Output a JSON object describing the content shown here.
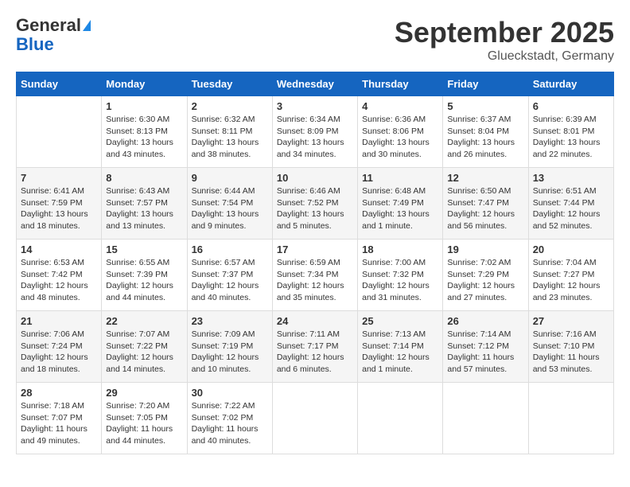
{
  "header": {
    "logo_general": "General",
    "logo_blue": "Blue",
    "month": "September 2025",
    "location": "Glueckstadt, Germany"
  },
  "days_of_week": [
    "Sunday",
    "Monday",
    "Tuesday",
    "Wednesday",
    "Thursday",
    "Friday",
    "Saturday"
  ],
  "weeks": [
    [
      {
        "day": "",
        "info": ""
      },
      {
        "day": "1",
        "info": "Sunrise: 6:30 AM\nSunset: 8:13 PM\nDaylight: 13 hours\nand 43 minutes."
      },
      {
        "day": "2",
        "info": "Sunrise: 6:32 AM\nSunset: 8:11 PM\nDaylight: 13 hours\nand 38 minutes."
      },
      {
        "day": "3",
        "info": "Sunrise: 6:34 AM\nSunset: 8:09 PM\nDaylight: 13 hours\nand 34 minutes."
      },
      {
        "day": "4",
        "info": "Sunrise: 6:36 AM\nSunset: 8:06 PM\nDaylight: 13 hours\nand 30 minutes."
      },
      {
        "day": "5",
        "info": "Sunrise: 6:37 AM\nSunset: 8:04 PM\nDaylight: 13 hours\nand 26 minutes."
      },
      {
        "day": "6",
        "info": "Sunrise: 6:39 AM\nSunset: 8:01 PM\nDaylight: 13 hours\nand 22 minutes."
      }
    ],
    [
      {
        "day": "7",
        "info": "Sunrise: 6:41 AM\nSunset: 7:59 PM\nDaylight: 13 hours\nand 18 minutes."
      },
      {
        "day": "8",
        "info": "Sunrise: 6:43 AM\nSunset: 7:57 PM\nDaylight: 13 hours\nand 13 minutes."
      },
      {
        "day": "9",
        "info": "Sunrise: 6:44 AM\nSunset: 7:54 PM\nDaylight: 13 hours\nand 9 minutes."
      },
      {
        "day": "10",
        "info": "Sunrise: 6:46 AM\nSunset: 7:52 PM\nDaylight: 13 hours\nand 5 minutes."
      },
      {
        "day": "11",
        "info": "Sunrise: 6:48 AM\nSunset: 7:49 PM\nDaylight: 13 hours\nand 1 minute."
      },
      {
        "day": "12",
        "info": "Sunrise: 6:50 AM\nSunset: 7:47 PM\nDaylight: 12 hours\nand 56 minutes."
      },
      {
        "day": "13",
        "info": "Sunrise: 6:51 AM\nSunset: 7:44 PM\nDaylight: 12 hours\nand 52 minutes."
      }
    ],
    [
      {
        "day": "14",
        "info": "Sunrise: 6:53 AM\nSunset: 7:42 PM\nDaylight: 12 hours\nand 48 minutes."
      },
      {
        "day": "15",
        "info": "Sunrise: 6:55 AM\nSunset: 7:39 PM\nDaylight: 12 hours\nand 44 minutes."
      },
      {
        "day": "16",
        "info": "Sunrise: 6:57 AM\nSunset: 7:37 PM\nDaylight: 12 hours\nand 40 minutes."
      },
      {
        "day": "17",
        "info": "Sunrise: 6:59 AM\nSunset: 7:34 PM\nDaylight: 12 hours\nand 35 minutes."
      },
      {
        "day": "18",
        "info": "Sunrise: 7:00 AM\nSunset: 7:32 PM\nDaylight: 12 hours\nand 31 minutes."
      },
      {
        "day": "19",
        "info": "Sunrise: 7:02 AM\nSunset: 7:29 PM\nDaylight: 12 hours\nand 27 minutes."
      },
      {
        "day": "20",
        "info": "Sunrise: 7:04 AM\nSunset: 7:27 PM\nDaylight: 12 hours\nand 23 minutes."
      }
    ],
    [
      {
        "day": "21",
        "info": "Sunrise: 7:06 AM\nSunset: 7:24 PM\nDaylight: 12 hours\nand 18 minutes."
      },
      {
        "day": "22",
        "info": "Sunrise: 7:07 AM\nSunset: 7:22 PM\nDaylight: 12 hours\nand 14 minutes."
      },
      {
        "day": "23",
        "info": "Sunrise: 7:09 AM\nSunset: 7:19 PM\nDaylight: 12 hours\nand 10 minutes."
      },
      {
        "day": "24",
        "info": "Sunrise: 7:11 AM\nSunset: 7:17 PM\nDaylight: 12 hours\nand 6 minutes."
      },
      {
        "day": "25",
        "info": "Sunrise: 7:13 AM\nSunset: 7:14 PM\nDaylight: 12 hours\nand 1 minute."
      },
      {
        "day": "26",
        "info": "Sunrise: 7:14 AM\nSunset: 7:12 PM\nDaylight: 11 hours\nand 57 minutes."
      },
      {
        "day": "27",
        "info": "Sunrise: 7:16 AM\nSunset: 7:10 PM\nDaylight: 11 hours\nand 53 minutes."
      }
    ],
    [
      {
        "day": "28",
        "info": "Sunrise: 7:18 AM\nSunset: 7:07 PM\nDaylight: 11 hours\nand 49 minutes."
      },
      {
        "day": "29",
        "info": "Sunrise: 7:20 AM\nSunset: 7:05 PM\nDaylight: 11 hours\nand 44 minutes."
      },
      {
        "day": "30",
        "info": "Sunrise: 7:22 AM\nSunset: 7:02 PM\nDaylight: 11 hours\nand 40 minutes."
      },
      {
        "day": "",
        "info": ""
      },
      {
        "day": "",
        "info": ""
      },
      {
        "day": "",
        "info": ""
      },
      {
        "day": "",
        "info": ""
      }
    ]
  ]
}
